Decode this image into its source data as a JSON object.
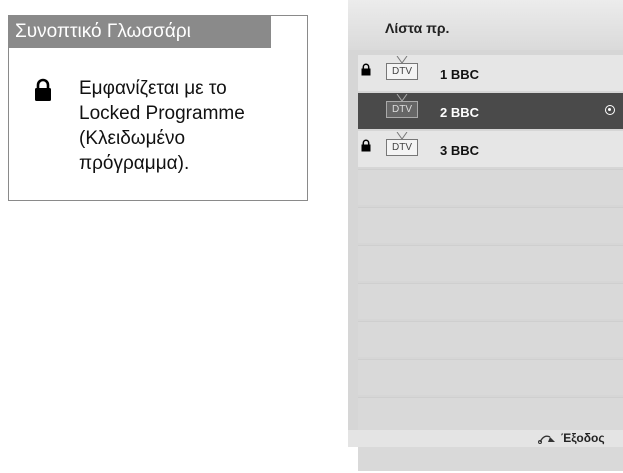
{
  "glossary": {
    "title": "Συνοπτικό Γλωσσάρι",
    "icon": "lock-icon",
    "lines": [
      "Εμφανίζεται με το",
      "Locked Programme",
      "(Κλειδωμένο",
      "πρόγραμμα)."
    ]
  },
  "channel_list": {
    "title": "Λίστα πρ.",
    "channels": [
      {
        "type": "DTV",
        "label": "1 BBC",
        "locked": true,
        "selected": false
      },
      {
        "type": "DTV",
        "label": "2 BBC",
        "locked": false,
        "selected": true
      },
      {
        "type": "DTV",
        "label": "3 BBC",
        "locked": true,
        "selected": false
      }
    ],
    "empty_rows": 8,
    "footer": {
      "exit_label": "Έξοδος",
      "exit_icon": "return-arrow-icon"
    }
  },
  "colors": {
    "glossary_header": "#8a8a8a",
    "panel_bg": "#d6d6d6",
    "selected_row": "#4a4a4a"
  }
}
